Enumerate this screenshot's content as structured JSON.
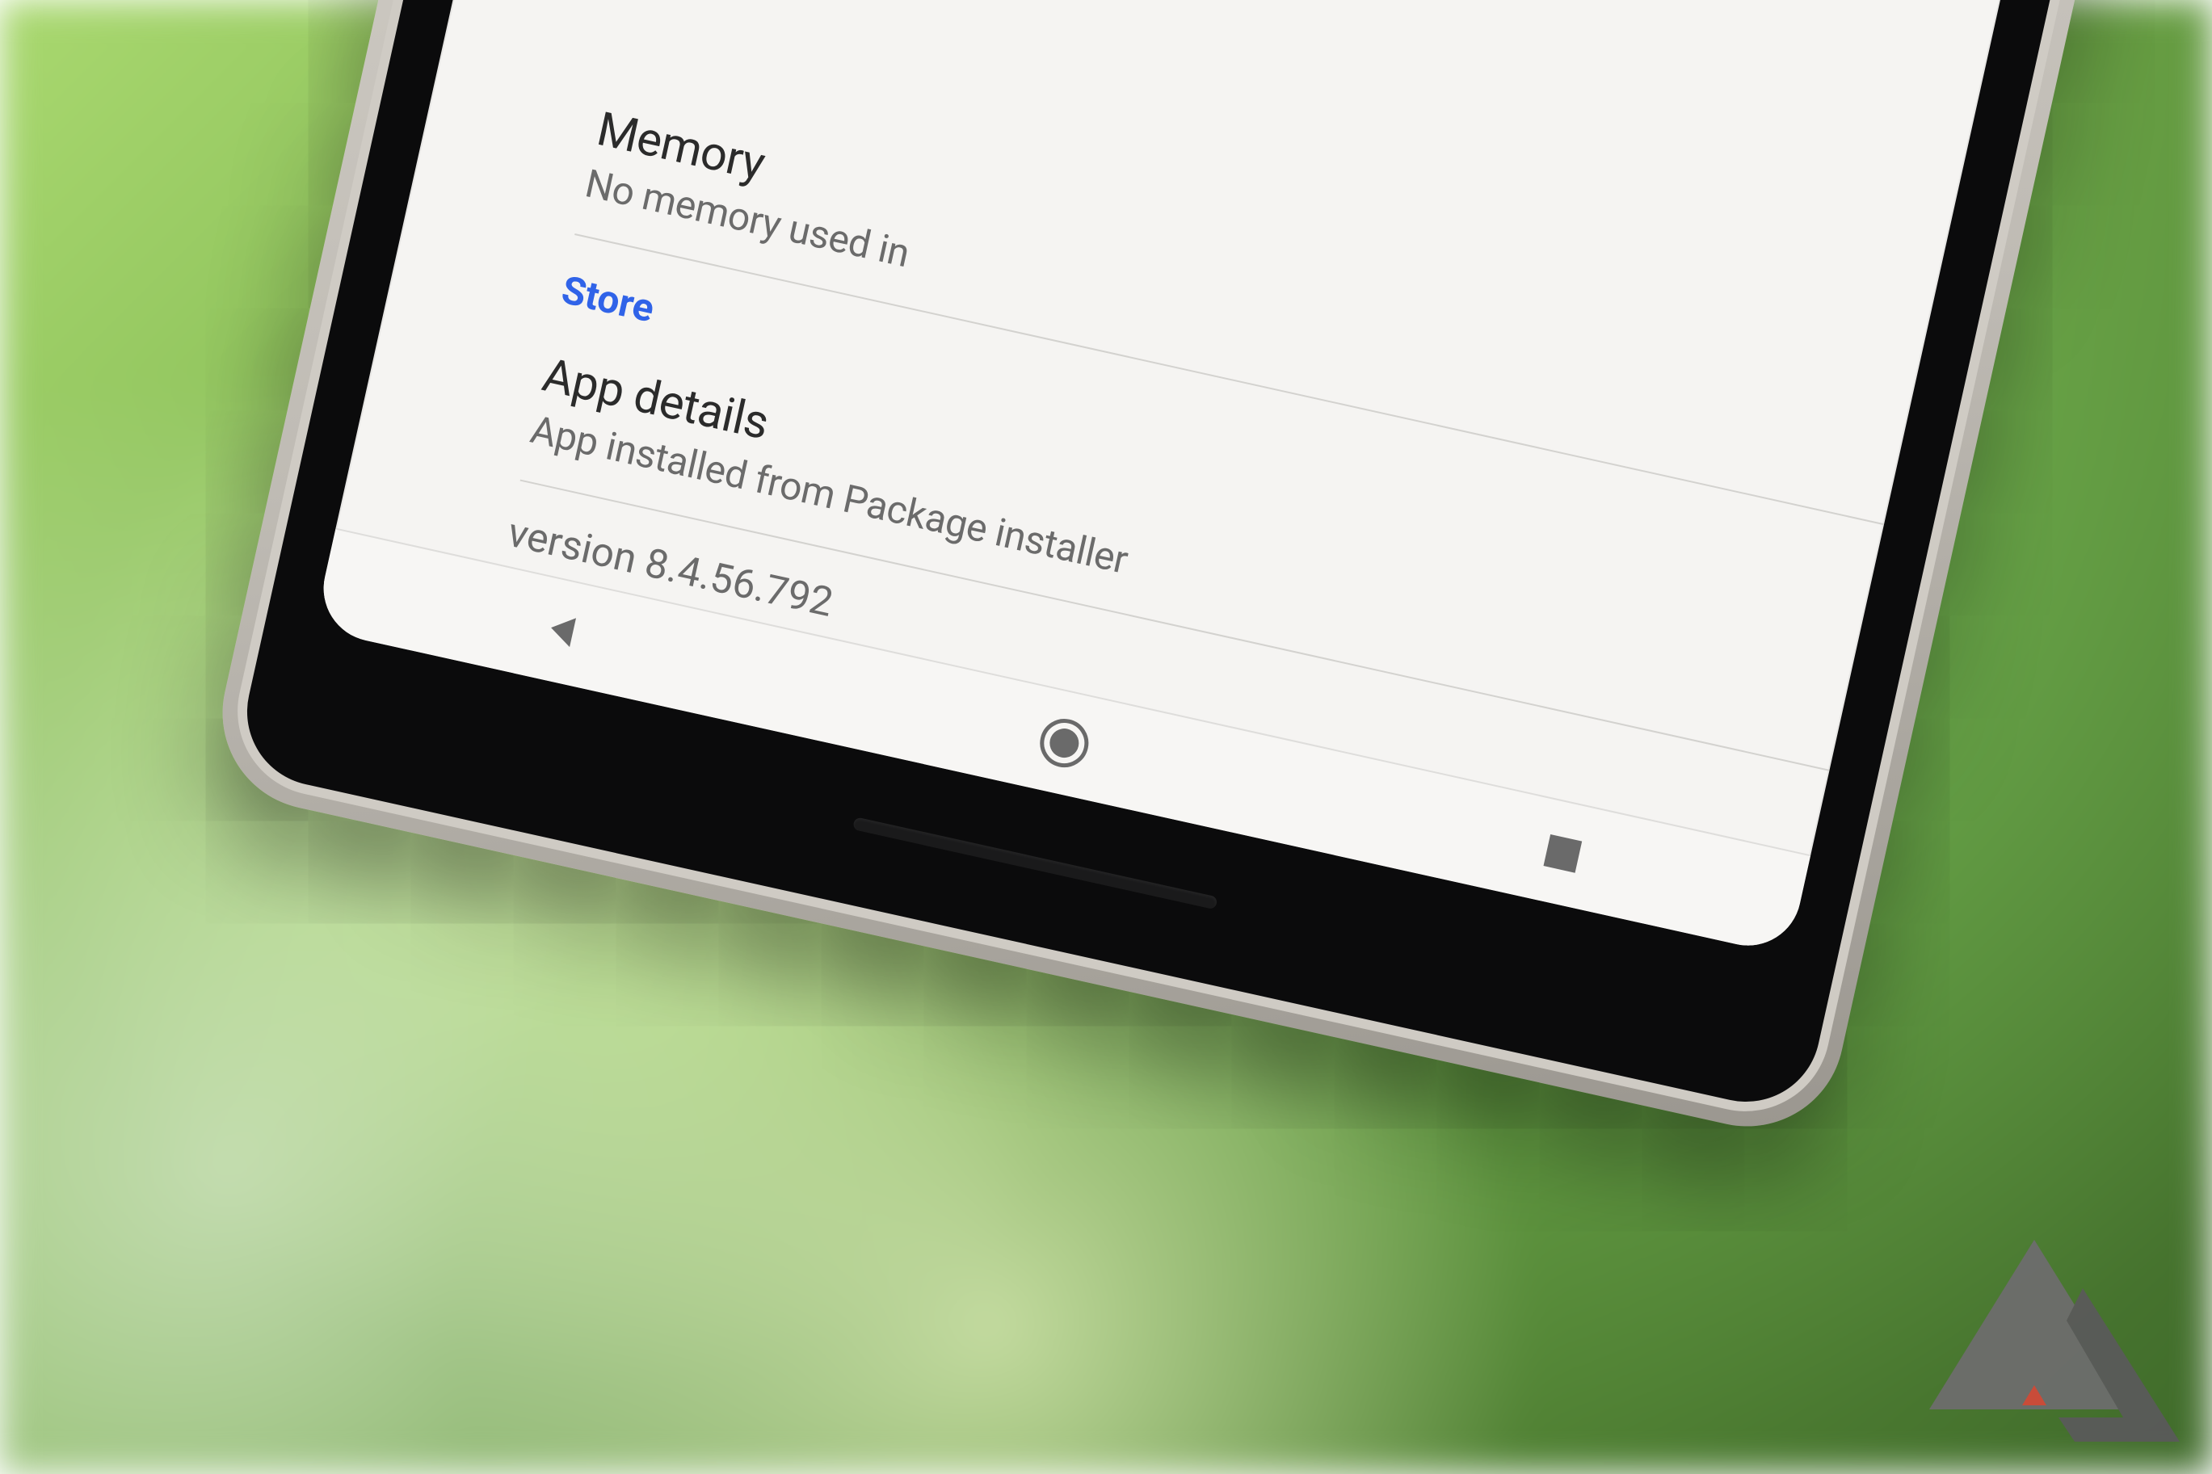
{
  "memory": {
    "title": "Memory",
    "subtitle_visible_fragment": "No memory used in"
  },
  "store": {
    "section_label": "Store",
    "app_details_title": "App details",
    "app_details_subtitle": "App installed from Package installer"
  },
  "version_text": "version 8.4.56.792",
  "navbar": {
    "back": "back",
    "home": "home",
    "recent": "recent"
  },
  "icons": {
    "back": "nav-back-triangle-icon",
    "home": "nav-home-circle-icon",
    "recent": "nav-recent-square-icon"
  },
  "watermark": "AP"
}
